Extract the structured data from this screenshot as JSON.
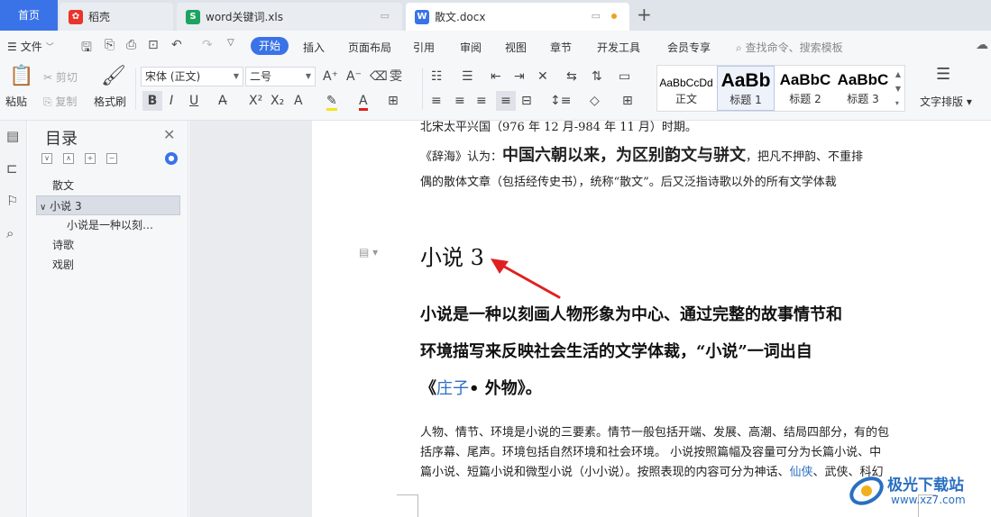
{
  "tabs": {
    "home": "首页",
    "t1": "稻壳",
    "t2": "word关键词.xls",
    "t3": "散文.docx"
  },
  "menu": {
    "file": "文件",
    "start": "开始",
    "items": [
      "插入",
      "页面布局",
      "引用",
      "审阅",
      "视图",
      "章节",
      "开发工具",
      "会员专享"
    ],
    "search": "查找命令、搜索模板"
  },
  "ribbon": {
    "cut": "剪切",
    "paste": "粘贴",
    "copy": "复制",
    "format_painter": "格式刷",
    "font": "宋体 (正文)",
    "size": "二号",
    "text_layout": "文字排版",
    "styles": [
      {
        "sample": "AaBbCcDd",
        "label": "正文"
      },
      {
        "sample": "AaBb",
        "label": "标题 1"
      },
      {
        "sample": "AaBbC",
        "label": "标题 2"
      },
      {
        "sample": "AaBbC",
        "label": "标题 3"
      }
    ]
  },
  "outline": {
    "title": "目录",
    "items": [
      "散文",
      "小说 3",
      "小说是一种以刻…",
      "诗歌",
      "戏剧"
    ]
  },
  "doc": {
    "line1": "北宋太平兴国（976 年 12 月-984 年 11 月）时期。",
    "line2_a": "《辞海》认为：",
    "line2_b": "中国六朝以来，为区别韵文与骈文",
    "line2_c": "，把凡不押韵、不重排",
    "line3": "偶的散体文章（包括经传史书），统称“散文”。后又泛指诗歌以外的所有文学体裁",
    "heading": "小说 3",
    "bold1": "小说是一种以刻画人物形象为中心、通过完整的故事情节和",
    "bold2": "环境描写来反映社会生活的文学体裁，“小说”一词出自",
    "bold3_a": "《",
    "bold3_b": "庄子",
    "bold3_c": "• 外物》。",
    "body1": "人物、情节、环境是小说的三要素。情节一般包括开端、发展、高潮、结局四部分，有的包",
    "body2": "括序幕、尾声。环境包括自然环境和社会环境。 小说按照篇幅及容量可分为长篇小说、中",
    "body3_a": "篇小说、短篇小说和微型小说（小小说）。按照表现的内容可分为神话、",
    "body3_b": "仙侠",
    "body3_c": "、武侠、科幻"
  },
  "watermark": {
    "name": "极光下载站",
    "url": "www.xz7.com"
  }
}
